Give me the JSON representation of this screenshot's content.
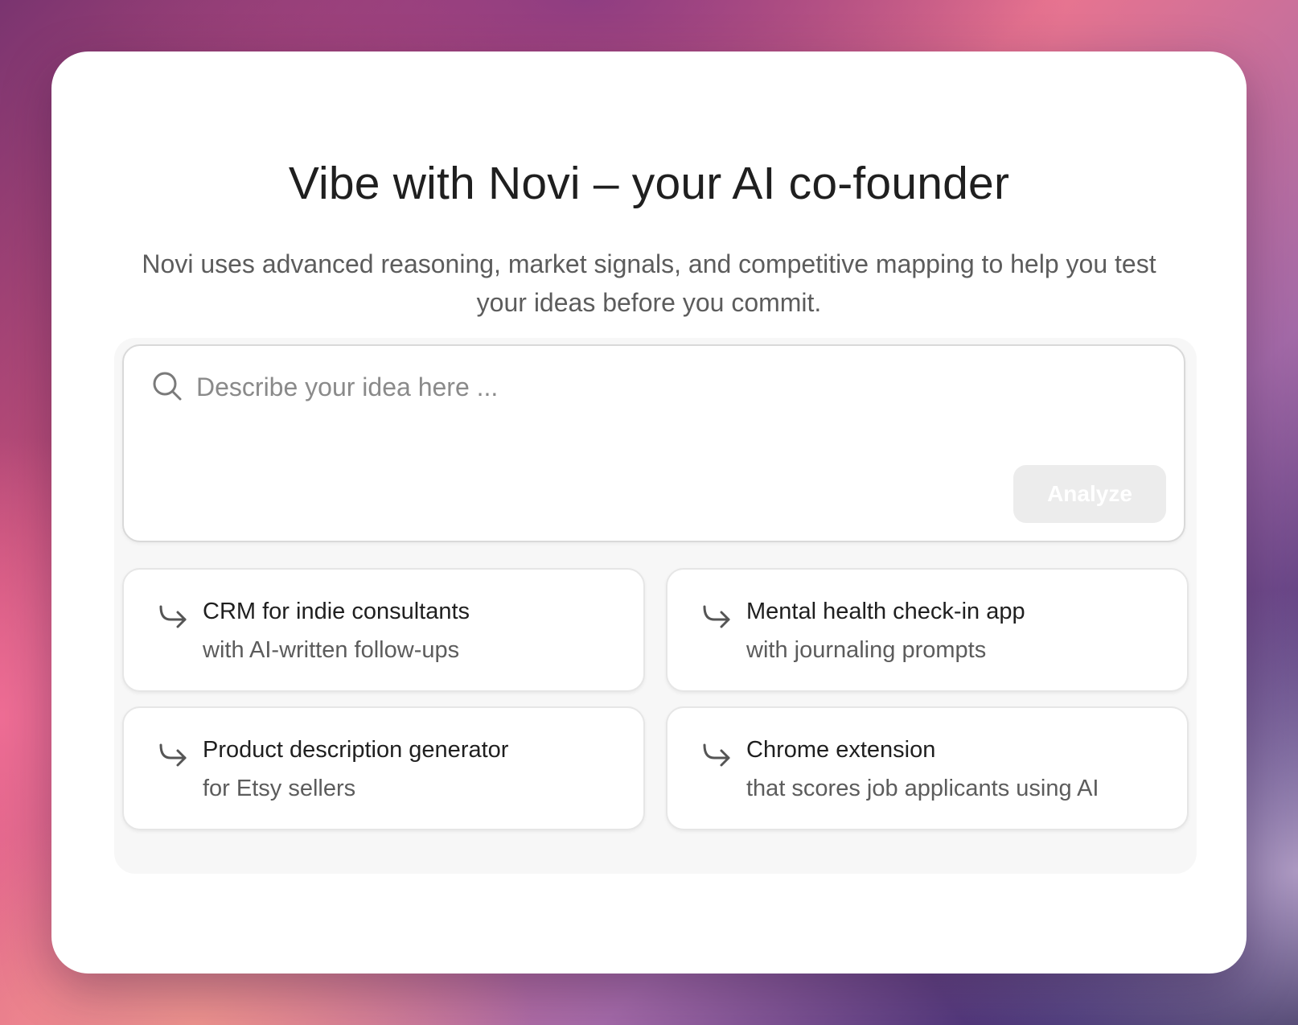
{
  "hero": {
    "title": "Vibe with Novi – your AI co-founder",
    "subtitle": "Novi uses advanced reasoning, market signals, and competitive mapping to help you test your ideas before you commit."
  },
  "search": {
    "icon": "search-icon",
    "placeholder": "Describe your idea here ...",
    "value": "",
    "analyze_label": "Analyze"
  },
  "suggestions": [
    {
      "icon": "arrow-turn-icon",
      "title": "CRM for indie consultants",
      "subtitle": "with AI-written follow-ups"
    },
    {
      "icon": "arrow-turn-icon",
      "title": "Mental health check-in app",
      "subtitle": "with journaling prompts"
    },
    {
      "icon": "arrow-turn-icon",
      "title": "Product description generator",
      "subtitle": "for Etsy sellers"
    },
    {
      "icon": "arrow-turn-icon",
      "title": "Chrome extension",
      "subtitle": "that scores job applicants using AI"
    }
  ],
  "colors": {
    "card_background": "#ffffff",
    "panel_background": "#f7f7f7",
    "button_disabled": "#ececec",
    "title_text": "#1f1f1f",
    "muted_text": "#5c5c5c"
  }
}
